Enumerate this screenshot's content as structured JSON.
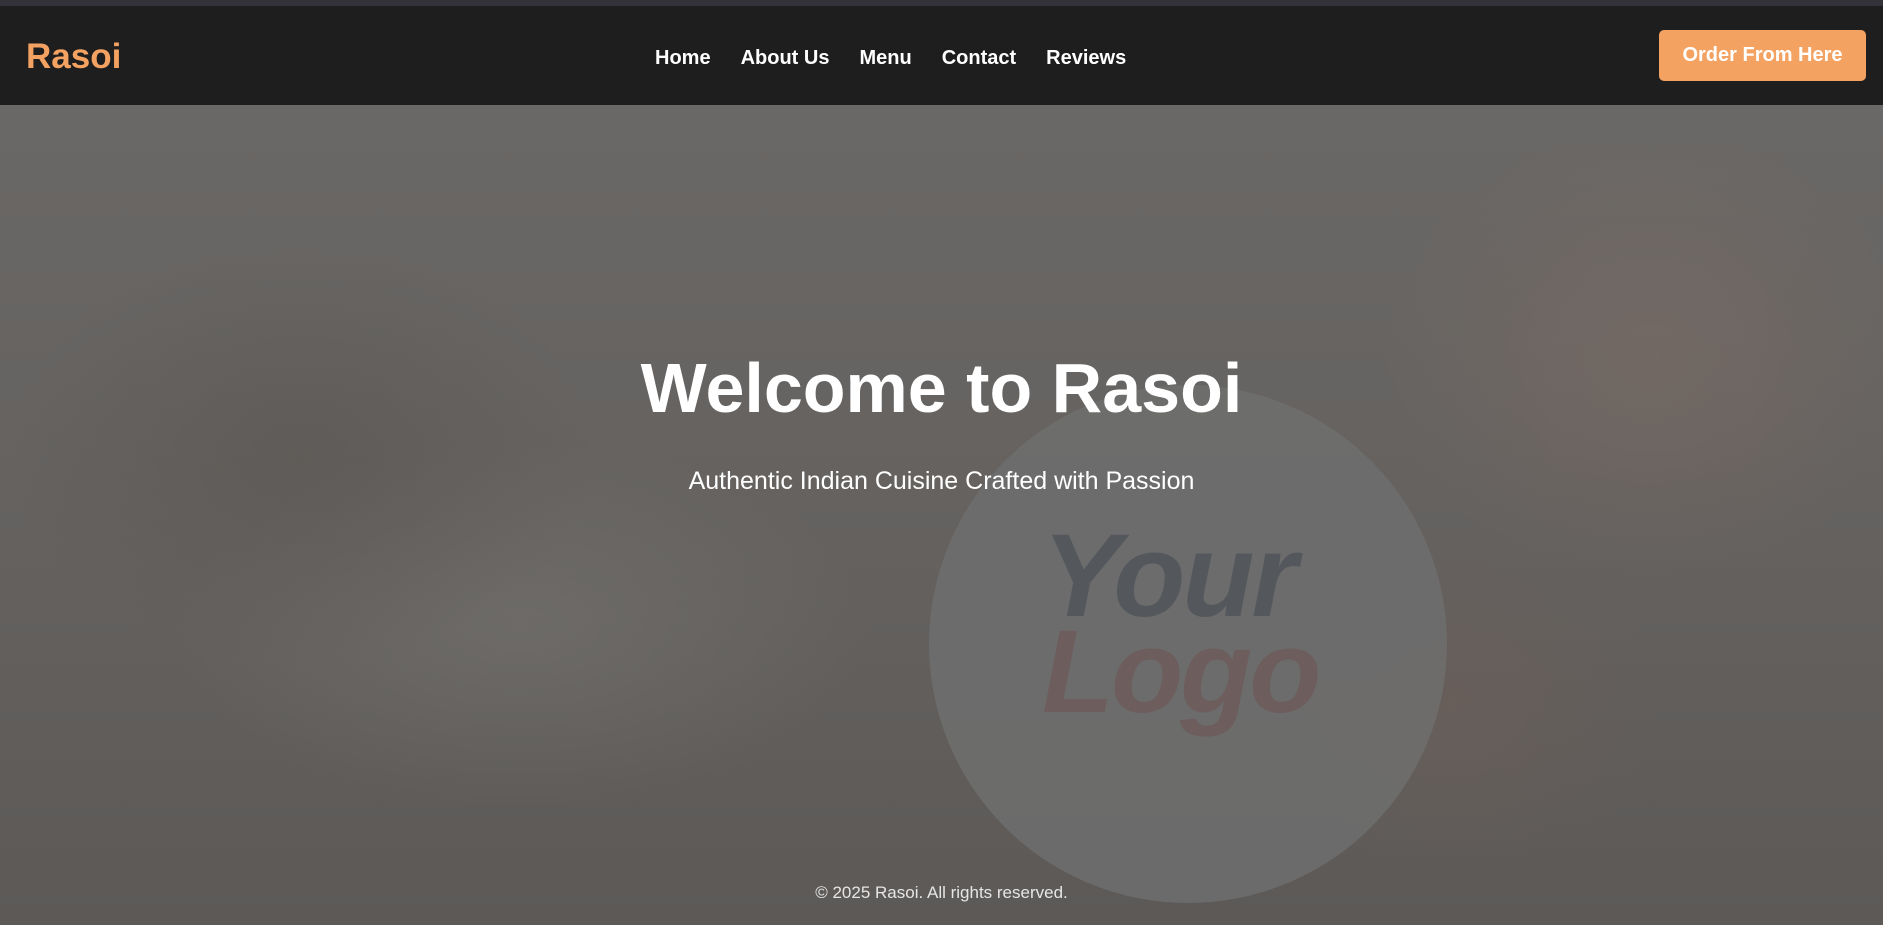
{
  "colors": {
    "brand": "#f4a261",
    "navbar_bg": "#1e1e1e",
    "text_light": "#ffffff"
  },
  "navbar": {
    "brand": "Rasoi",
    "links": [
      {
        "label": "Home"
      },
      {
        "label": "About Us"
      },
      {
        "label": "Menu"
      },
      {
        "label": "Contact"
      },
      {
        "label": "Reviews"
      }
    ],
    "order_button": "Order From Here"
  },
  "hero": {
    "title": "Welcome to Rasoi",
    "subtitle": "Authentic Indian Cuisine Crafted with Passion",
    "logo_placeholder": {
      "line1": "Your",
      "line2": "Logo"
    }
  },
  "footer": {
    "copyright": "© 2025 Rasoi. All rights reserved."
  }
}
